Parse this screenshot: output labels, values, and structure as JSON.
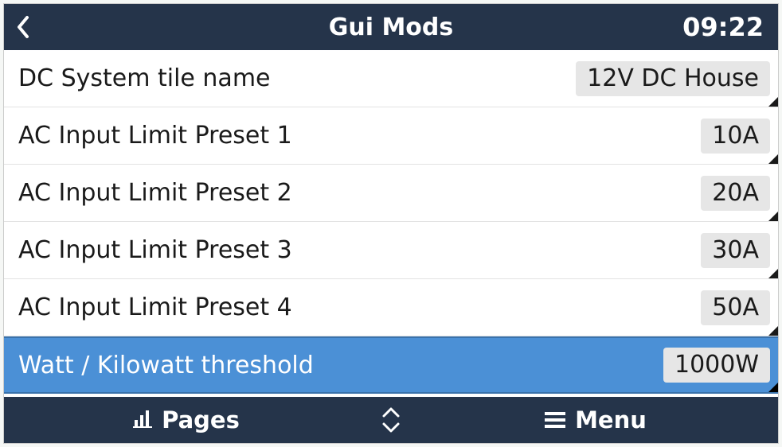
{
  "header": {
    "title": "Gui Mods",
    "time": "09:22"
  },
  "rows": [
    {
      "label": "DC System tile name",
      "value": "12V DC House",
      "selected": false
    },
    {
      "label": "AC Input Limit Preset 1",
      "value": "10A",
      "selected": false
    },
    {
      "label": "AC Input Limit Preset 2",
      "value": "20A",
      "selected": false
    },
    {
      "label": "AC Input Limit Preset 3",
      "value": "30A",
      "selected": false
    },
    {
      "label": "AC Input Limit Preset 4",
      "value": "50A",
      "selected": false
    },
    {
      "label": "Watt / Kilowatt threshold",
      "value": "1000W",
      "selected": true
    }
  ],
  "footer": {
    "pages_label": "Pages",
    "menu_label": "Menu"
  }
}
